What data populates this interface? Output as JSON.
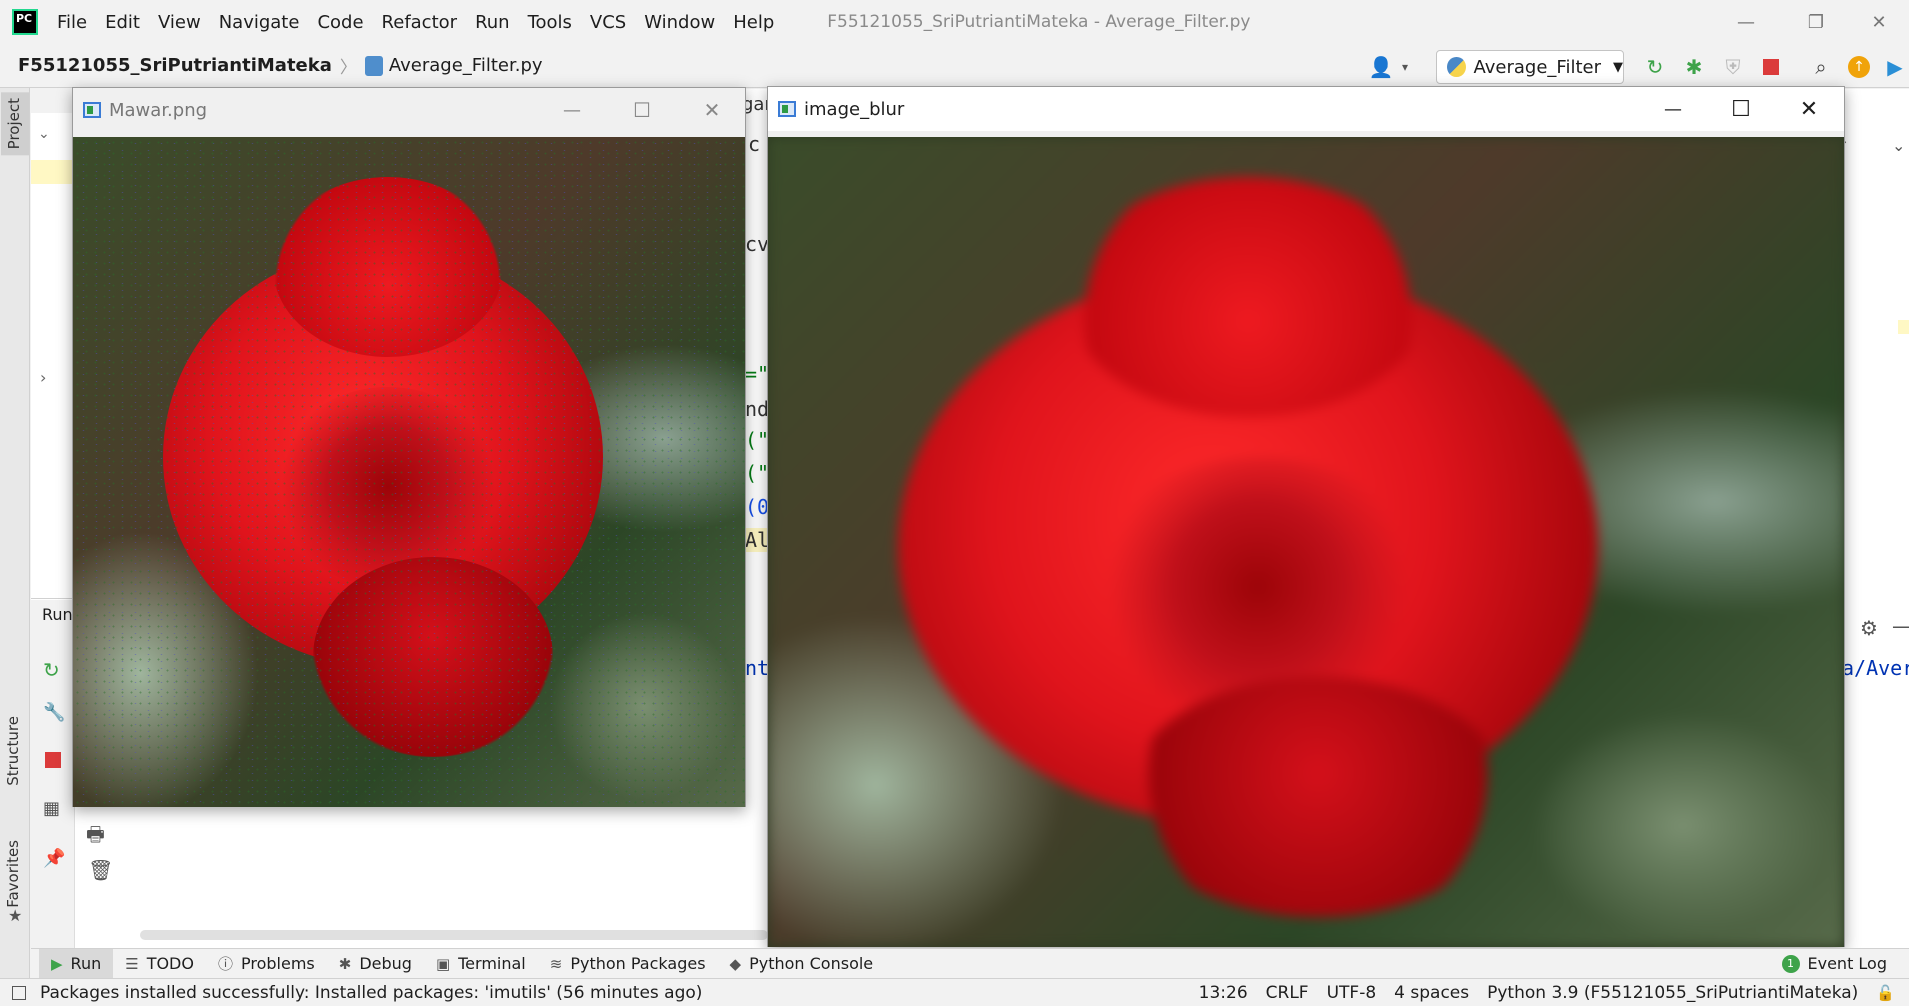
{
  "menubar": {
    "app_logo": "PC",
    "items": [
      "File",
      "Edit",
      "View",
      "Navigate",
      "Code",
      "Refactor",
      "Run",
      "Tools",
      "VCS",
      "Window",
      "Help"
    ],
    "window_title": "F55121055_SriPutriantiMateka - Average_Filter.py",
    "minimize": "—",
    "restore": "❐",
    "close": "✕"
  },
  "navbar": {
    "project": "F55121055_SriPutriantiMateka",
    "separator": "〉",
    "file": "Average_Filter.py",
    "run_config": "Average_Filter",
    "run_config_arrow": "▼"
  },
  "side_tabs": {
    "project": "Project",
    "structure": "Structure",
    "favorites": "Favorites"
  },
  "run_panel": {
    "label": "Run"
  },
  "editor_peek": {
    "lines": [
      "c",
      "cv",
      "=\"",
      "nd",
      "(\"",
      "(\"",
      "(0",
      "Al",
      "nti"
    ],
    "tab_fragment": "gar",
    "path_fragment": "a/Aver"
  },
  "image_windows": [
    {
      "title": "Mawar.png",
      "minimize": "—",
      "maximize": "☐",
      "close": "✕"
    },
    {
      "title": "image_blur",
      "minimize": "—",
      "maximize": "☐",
      "close": "✕"
    }
  ],
  "bottom_tabs": [
    {
      "label": "Run",
      "icon": "run-icon",
      "glyph": "▶"
    },
    {
      "label": "TODO",
      "icon": "list-icon",
      "glyph": "☰"
    },
    {
      "label": "Problems",
      "icon": "info-icon",
      "glyph": "ⓘ"
    },
    {
      "label": "Debug",
      "icon": "bug-icon",
      "glyph": "✱"
    },
    {
      "label": "Terminal",
      "icon": "terminal-icon",
      "glyph": "▣"
    },
    {
      "label": "Python Packages",
      "icon": "layers-icon",
      "glyph": "≋"
    },
    {
      "label": "Python Console",
      "icon": "python-icon",
      "glyph": "◆"
    }
  ],
  "event_log": {
    "label": "Event Log",
    "badge": "1"
  },
  "statusbar": {
    "message": "Packages installed successfully: Installed packages: 'imutils' (56 minutes ago)",
    "position": "13:26",
    "line_sep": "CRLF",
    "encoding": "UTF-8",
    "indent": "4 spaces",
    "interpreter": "Python 3.9 (F55121055_SriPutriantiMateka)"
  },
  "colors": {
    "accent_green": "#3ea34a",
    "stop_red": "#db3b3b",
    "update_orange": "#f0a30a",
    "rose_red": "#e0141c"
  }
}
